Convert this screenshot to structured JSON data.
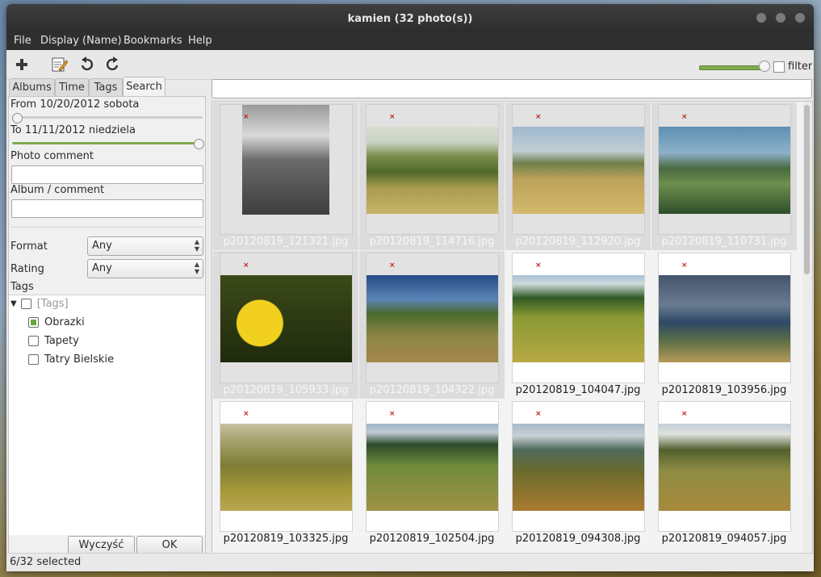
{
  "window": {
    "title": "kamien (32 photo(s))"
  },
  "menu": [
    "File",
    "Display (Name)",
    "Bookmarks",
    "Help"
  ],
  "toolbar": {
    "filter_label": "filter",
    "zoom_level": 0.92
  },
  "tabs": [
    "Albums",
    "Time",
    "Tags",
    "Search"
  ],
  "search": {
    "from_label": "From 10/20/2012 sobota",
    "to_label": "To 11/11/2012 niedziela",
    "photo_comment_label": "Photo comment",
    "album_comment_label": "Album / comment",
    "format_label": "Format",
    "format_value": "Any",
    "rating_label": "Rating",
    "rating_value": "Any",
    "tags_label": "Tags",
    "clear_button": "Wyczyść",
    "ok_button": "OK"
  },
  "tags_tree": {
    "root": "[Tags]",
    "items": [
      {
        "label": "Obrazki",
        "checked": true
      },
      {
        "label": "Tapety",
        "checked": false
      },
      {
        "label": "Tatry Bielskie",
        "checked": false
      }
    ]
  },
  "photos": [
    {
      "name": "p20120819_121321.jpg",
      "selected": true,
      "palette": "bw"
    },
    {
      "name": "p20120819_114716.jpg",
      "selected": true,
      "palette": "hills"
    },
    {
      "name": "p20120819_112920.jpg",
      "selected": true,
      "palette": "grass"
    },
    {
      "name": "p20120819_110731.jpg",
      "selected": true,
      "palette": "valley"
    },
    {
      "name": "p20120819_105933.jpg",
      "selected": true,
      "palette": "flowers"
    },
    {
      "name": "p20120819_104322.jpg",
      "selected": true,
      "palette": "meadow"
    },
    {
      "name": "p20120819_104047.jpg",
      "selected": false,
      "palette": "field"
    },
    {
      "name": "p20120819_103956.jpg",
      "selected": false,
      "palette": "heli"
    },
    {
      "name": "p20120819_103325.jpg",
      "selected": false,
      "palette": "tree"
    },
    {
      "name": "p20120819_102504.jpg",
      "selected": false,
      "palette": "slope"
    },
    {
      "name": "p20120819_094308.jpg",
      "selected": false,
      "palette": "dry"
    },
    {
      "name": "p20120819_094057.jpg",
      "selected": false,
      "palette": "path"
    }
  ],
  "status": {
    "text": "6/32 selected"
  },
  "colors": {
    "accent": "#7faa4f",
    "titlebar": "#2f2f2f",
    "selection": "#dcdcdc"
  }
}
